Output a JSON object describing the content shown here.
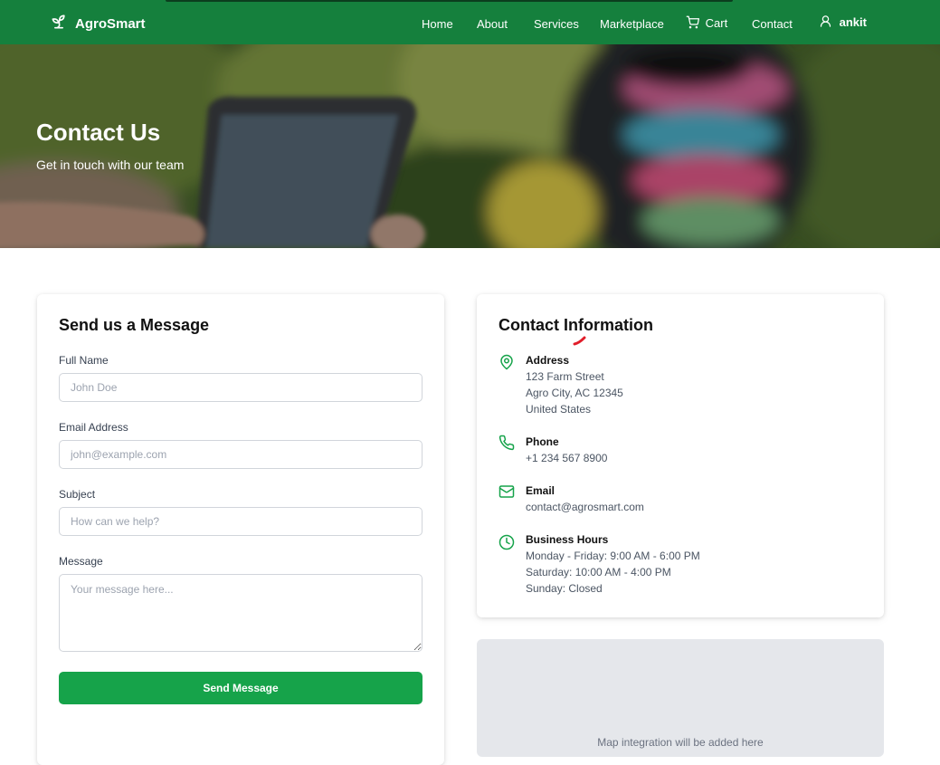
{
  "nav": {
    "brand": "AgroSmart",
    "links": [
      "Home",
      "About",
      "Services",
      "Marketplace",
      "Cart",
      "Contact"
    ],
    "user": "ankit"
  },
  "hero": {
    "title": "Contact Us",
    "subtitle": "Get in touch with our team"
  },
  "form": {
    "title": "Send us a Message",
    "fields": [
      {
        "label": "Full Name",
        "placeholder": "John Doe"
      },
      {
        "label": "Email Address",
        "placeholder": "john@example.com"
      },
      {
        "label": "Subject",
        "placeholder": "How can we help?"
      },
      {
        "label": "Message",
        "placeholder": "Your message here..."
      }
    ],
    "submit": "Send Message"
  },
  "info": {
    "title": "Contact Information",
    "items": [
      {
        "icon": "map-pin-icon",
        "label": "Address",
        "lines": [
          "123 Farm Street",
          "Agro City, AC 12345",
          "United States"
        ]
      },
      {
        "icon": "phone-icon",
        "label": "Phone",
        "lines": [
          "+1 234 567 8900"
        ]
      },
      {
        "icon": "mail-icon",
        "label": "Email",
        "lines": [
          "contact@agrosmart.com"
        ]
      },
      {
        "icon": "clock-icon",
        "label": "Business Hours",
        "lines": [
          "Monday - Friday: 9:00 AM - 6:00 PM",
          "Saturday: 10:00 AM - 4:00 PM",
          "Sunday: Closed"
        ]
      }
    ]
  },
  "map": {
    "placeholder_text": "Map integration will be added here"
  },
  "colors": {
    "nav_bg": "#15803d",
    "button": "#16a34a",
    "icon": "#16a34a"
  }
}
